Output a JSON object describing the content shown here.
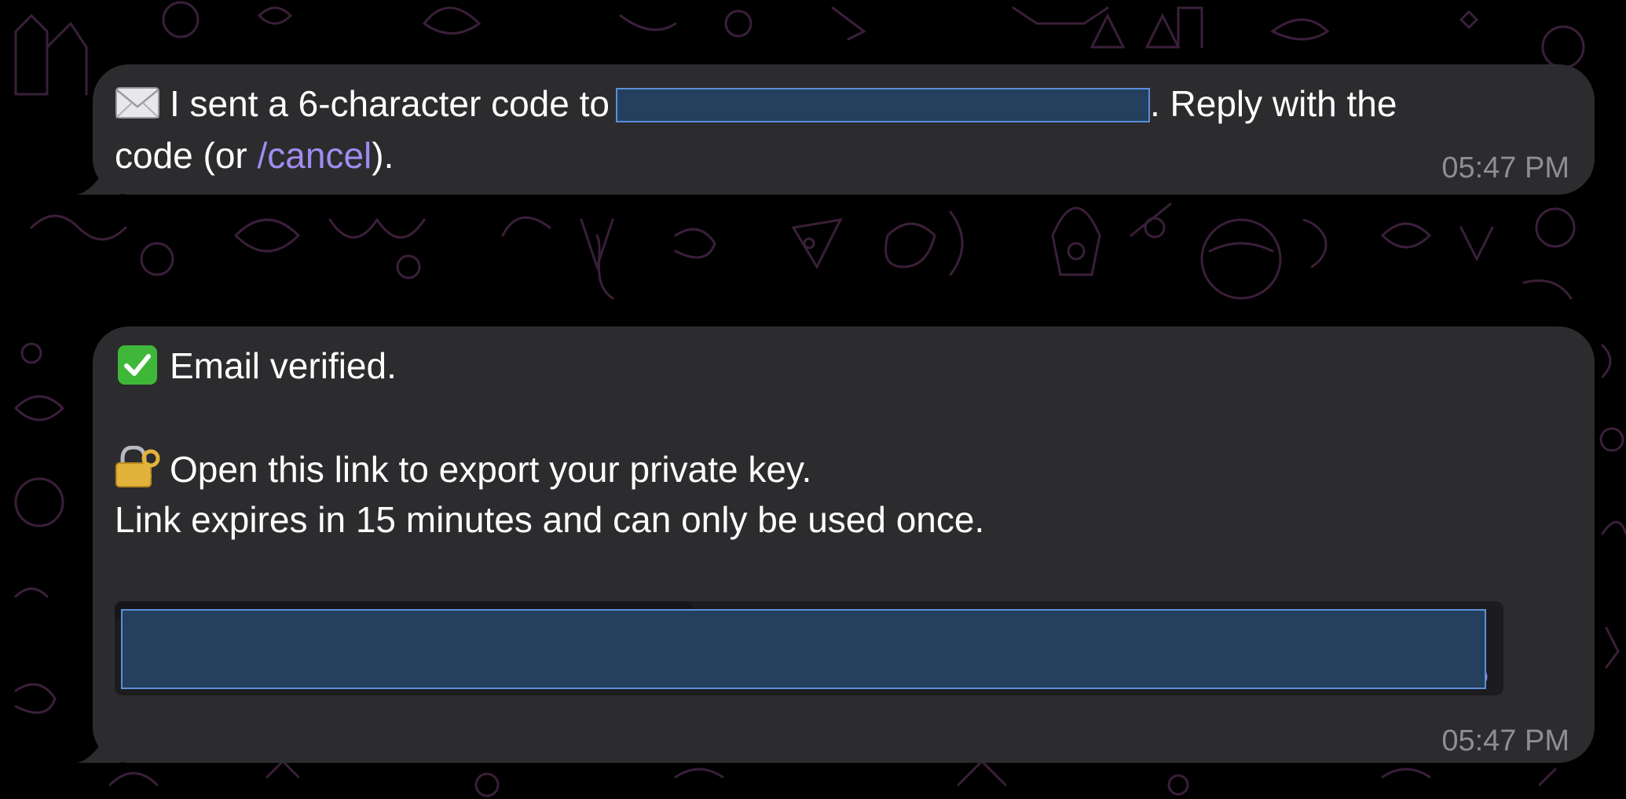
{
  "colors": {
    "background": "#000000",
    "bubble": "#2c2c2e",
    "text": "#ffffff",
    "link": "#a08cf0",
    "timestamp": "#8e8e93",
    "redaction_fill": "#24405e",
    "redaction_border": "#5b8fd8",
    "wallpaper_doodle": "#3a1f3a"
  },
  "messages": [
    {
      "icon": "envelope-icon",
      "line1_prefix": "I sent a 6-character code to",
      "line1_suffix": ". Reply with the",
      "line2_prefix": "code (or ",
      "command": "/cancel",
      "line2_suffix": ").",
      "time": "05:47 PM"
    },
    {
      "icon1": "check-mark-button-icon",
      "line1": "Email verified.",
      "icon2": "locked-with-key-icon",
      "line2": "Open this link to export your private key.",
      "line3": "Link expires in 15 minutes and can only be used once.",
      "code_tail": "6",
      "time": "05:47 PM"
    }
  ]
}
